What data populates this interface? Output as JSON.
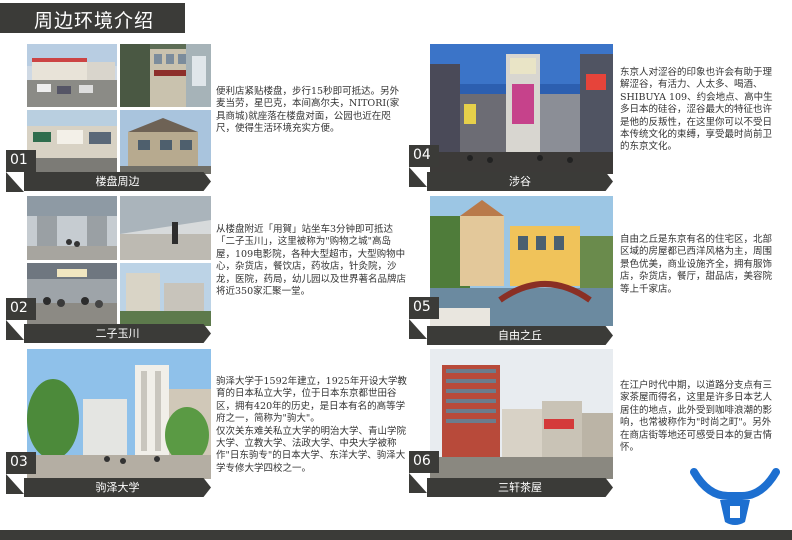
{
  "page": {
    "title": "周边环境介绍"
  },
  "sections": [
    {
      "number": "01",
      "caption": "楼盘周边",
      "description": "便利店紧贴楼盘，步行15秒即可抵达。另外麦当劳，星巴克，本间高尔夫，NITORI(家具商城)就座落在楼盘对面，公园也近在咫尺，使得生活环境充实方便。"
    },
    {
      "number": "02",
      "caption": "二子玉川",
      "description": "从楼盘附近「用賀」站坐车3分钟即可抵达「二子玉川」，这里被称为\"购物之城\"高岛屋，109电影院，各种大型超市，大型购物中心，杂货店，餐饮店，药妆店，针灸院，沙龙，医院，药局，幼儿园以及世界著名品牌店将近350家汇聚一堂。"
    },
    {
      "number": "03",
      "caption": "驹泽大学",
      "description": "驹泽大学于1592年建立，1925年开设大学教育的日本私立大学，位于日本东京都世田谷区，拥有420年的历史，是日本有名的高等学府之一，简称为\"驹大\"。\n仅次关东难关私立大学的明治大学、青山学院大学、立教大学、法政大学、中央大学被称作\"日东驹专\"的日本大学、东洋大学、驹泽大学专修大学四校之一。"
    },
    {
      "number": "04",
      "caption": "涉谷",
      "description": "东京人对涩谷的印象也许会有助于理解涩谷，有活力、人太多、喝酒、SHIBUYA 109、约会地点、高中生多日本的硅谷，涩谷最大的特征也许是他的反叛性，在这里你可以不受日本传统文化的束缚，享受最时尚前卫的东京文化。"
    },
    {
      "number": "05",
      "caption": "自由之丘",
      "description": "自由之丘是东京有名的住宅区，北部区域的房屋都已西洋风格为主，周围景色优美，商业设施齐全，拥有服饰店，杂货店，餐厅，甜品店，美容院等上千家店。"
    },
    {
      "number": "06",
      "caption": "三轩茶屋",
      "description": "在江户时代中期，以道路分支点有三家茶屋而得名，这里是许多日本艺人居住的地点，此外受到咖啡浪潮的影响，也常被称作为\"时尚之町\"。另外在商店街等地还可感受日本的复古情怀。"
    }
  ],
  "logo": {
    "name": "bull-horn-logo",
    "color": "#1d6fd0"
  },
  "colors": {
    "bar": "#3b3b38",
    "text": "#333333"
  }
}
